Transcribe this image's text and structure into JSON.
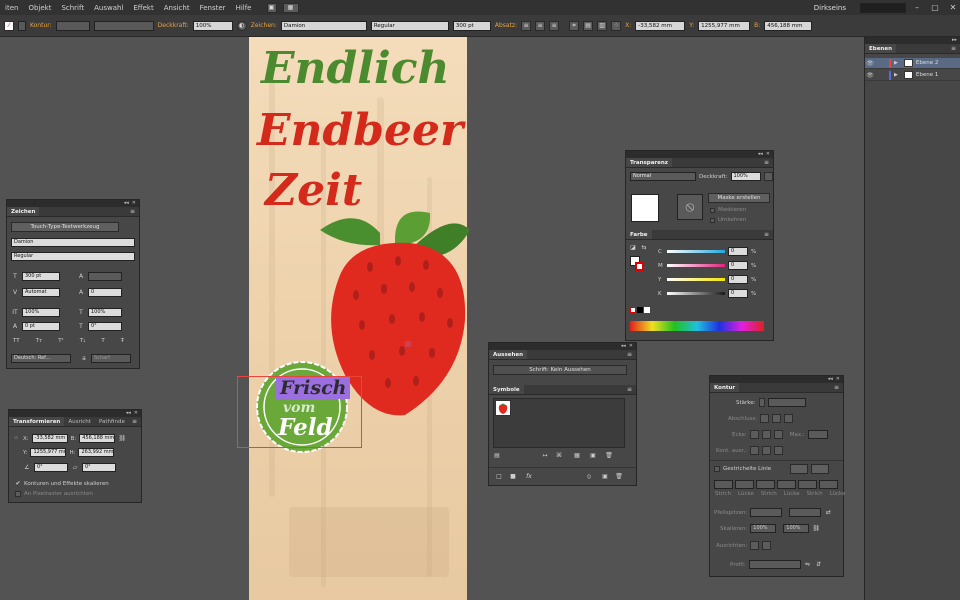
{
  "menubar": {
    "items": [
      "iten",
      "Objekt",
      "Schrift",
      "Auswahl",
      "Effekt",
      "Ansicht",
      "Fenster",
      "Hilfe"
    ],
    "workspace": "Dirkseins",
    "win_min": "–",
    "win_max": "▢",
    "win_close": "✕"
  },
  "controlbar": {
    "kontur_label": "Kontur:",
    "deckkraft_label": "Deckkraft:",
    "deckkraft_value": "100%",
    "zeichen_label": "Zeichen:",
    "font_value": "Damion",
    "style_value": "Regular",
    "size_value": "300 pt",
    "absatz_label": "Absatz:",
    "x_label": "X:",
    "x_value": "-33,582 mm",
    "y_label": "Y:",
    "y_value": "1255,977 mm",
    "b_label": "B:",
    "b_value": "456,188 mm"
  },
  "artboard": {
    "line1": "Endlich",
    "line2": "Endbeer",
    "line3": "Zeit",
    "badge_line1": "Frisch",
    "badge_line2": "vom",
    "badge_line3": "Feld"
  },
  "zeichen_panel": {
    "tab": "Zeichen",
    "touch_tool": "Touch-Type-Textwerkzeug",
    "font": "Damion",
    "style": "Regular",
    "size": "300 pt",
    "leading": "Automat",
    "kerning_left": "",
    "tracking": "0",
    "scale_v": "100%",
    "scale_h": "100%",
    "baseline": "0 pt",
    "rotation": "0°",
    "type_buttons": [
      "TT",
      "Tт",
      "T¹",
      "T₁",
      "T",
      "Ŧ"
    ],
    "language": "Deutsch: Ref...",
    "antialias": "Scharf"
  },
  "transform_panel": {
    "tabs": [
      "Transformieren",
      "Ausricht",
      "Pathfinde"
    ],
    "x_label": "X:",
    "x_value": "-33,582 mm",
    "y_label": "Y:",
    "y_value": "1255,977 mm",
    "b_label": "B:",
    "b_value": "456,188 mm",
    "h_label": "H:",
    "h_value": "263,992 mm",
    "angle_value": "0°",
    "shear_value": "0°",
    "scale_strokes": "Konturen und Effekte skalieren",
    "pixel_align": "An Pixelraster ausrichten"
  },
  "transparenz_panel": {
    "tab": "Transparenz",
    "mode": "Normal",
    "opacity_label": "Deckkraft:",
    "opacity_value": "100%",
    "mask_button": "Maske erstellen",
    "clip": "Maskieren",
    "invert": "Umkehren"
  },
  "farbe_panel": {
    "tab": "Farbe",
    "channels": [
      {
        "label": "C",
        "value": "0",
        "color": "#22a9e0"
      },
      {
        "label": "M",
        "value": "0",
        "color": "#e0237f"
      },
      {
        "label": "Y",
        "value": "0",
        "color": "#f2e500"
      },
      {
        "label": "K",
        "value": "0",
        "color": "#1a1a1a"
      }
    ],
    "percent": "%"
  },
  "aussehen_panel": {
    "tab": "Aussehen",
    "text": "Schrift: Kein Aussehen"
  },
  "symbole_panel": {
    "tab": "Symbole"
  },
  "kontur_panel": {
    "tab": "Kontur",
    "staerke_label": "Stärke:",
    "abschluss_label": "Abschluss:",
    "ecke_label": "Ecke:",
    "max_label": "Max.:",
    "kontur_ausrichten_label": "Kont. ausr.:",
    "dashed_label": "Gestrichelte Linie",
    "dash_labels": [
      "Strich",
      "Lücke",
      "Strich",
      "Lücke",
      "Strich",
      "Lücke"
    ],
    "pfeilspitzen_label": "Pfeilspitzen:",
    "skalieren_label": "Skalieren:",
    "scale1": "100%",
    "scale2": "100%",
    "ausrichten_label": "Ausrichten:",
    "profil_label": "Profil:"
  },
  "layers_panel": {
    "tab": "Ebenen",
    "layers": [
      {
        "name": "Ebene 2",
        "color": "#e8463c",
        "selected": true
      },
      {
        "name": "Ebene 1",
        "color": "#4f6ee0",
        "selected": false
      }
    ]
  }
}
